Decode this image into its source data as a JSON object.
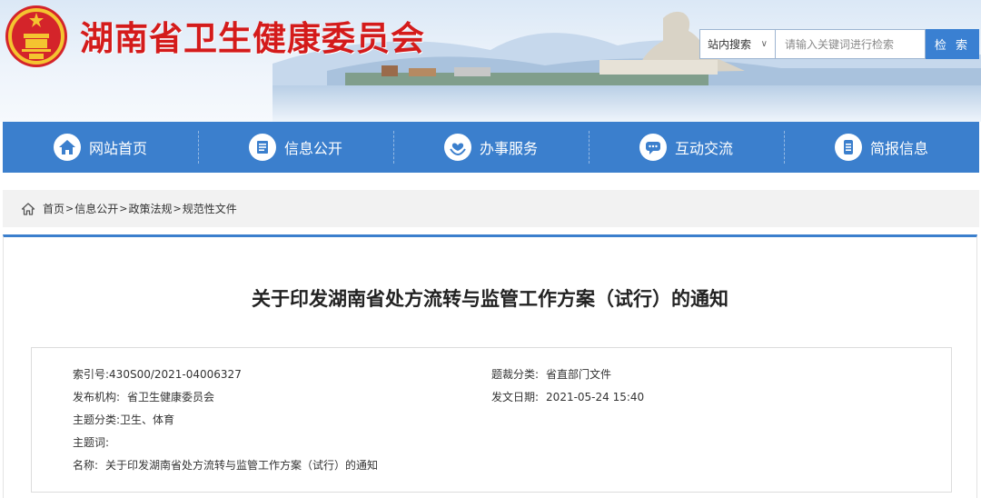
{
  "header": {
    "site_title": "湖南省卫生健康委员会",
    "search": {
      "scope": "站内搜索",
      "placeholder": "请输入关键词进行检索",
      "button": "检 索"
    }
  },
  "nav": {
    "items": [
      {
        "label": "网站首页",
        "icon": "home-icon"
      },
      {
        "label": "信息公开",
        "icon": "document-list-icon"
      },
      {
        "label": "办事服务",
        "icon": "heart-hands-icon"
      },
      {
        "label": "互动交流",
        "icon": "chat-bubble-icon"
      },
      {
        "label": "简报信息",
        "icon": "newsletter-icon"
      }
    ]
  },
  "breadcrumb": {
    "items": [
      "首页",
      "信息公开",
      "政策法规",
      "规范性文件"
    ],
    "separator": ">"
  },
  "article": {
    "title": "关于印发湖南省处方流转与监管工作方案（试行）的通知",
    "meta": {
      "index_no_label": "索引号:",
      "index_no": "430S00/2021-04006327",
      "category_label": "题裁分类:",
      "category": "省直部门文件",
      "publisher_label": "发布机构:",
      "publisher": "省卫生健康委员会",
      "date_label": "发文日期:",
      "date": "2021-05-24 15:40",
      "topic_label": "主题分类:",
      "topic": "卫生、体育",
      "keywords_label": "主题词:",
      "keywords": "",
      "name_label": "名称:",
      "name": "关于印发湖南省处方流转与监管工作方案（试行）的通知"
    }
  },
  "colors": {
    "brand_red": "#d41b1b",
    "nav_blue": "#3b7fcd",
    "search_blue": "#3a80d2"
  }
}
